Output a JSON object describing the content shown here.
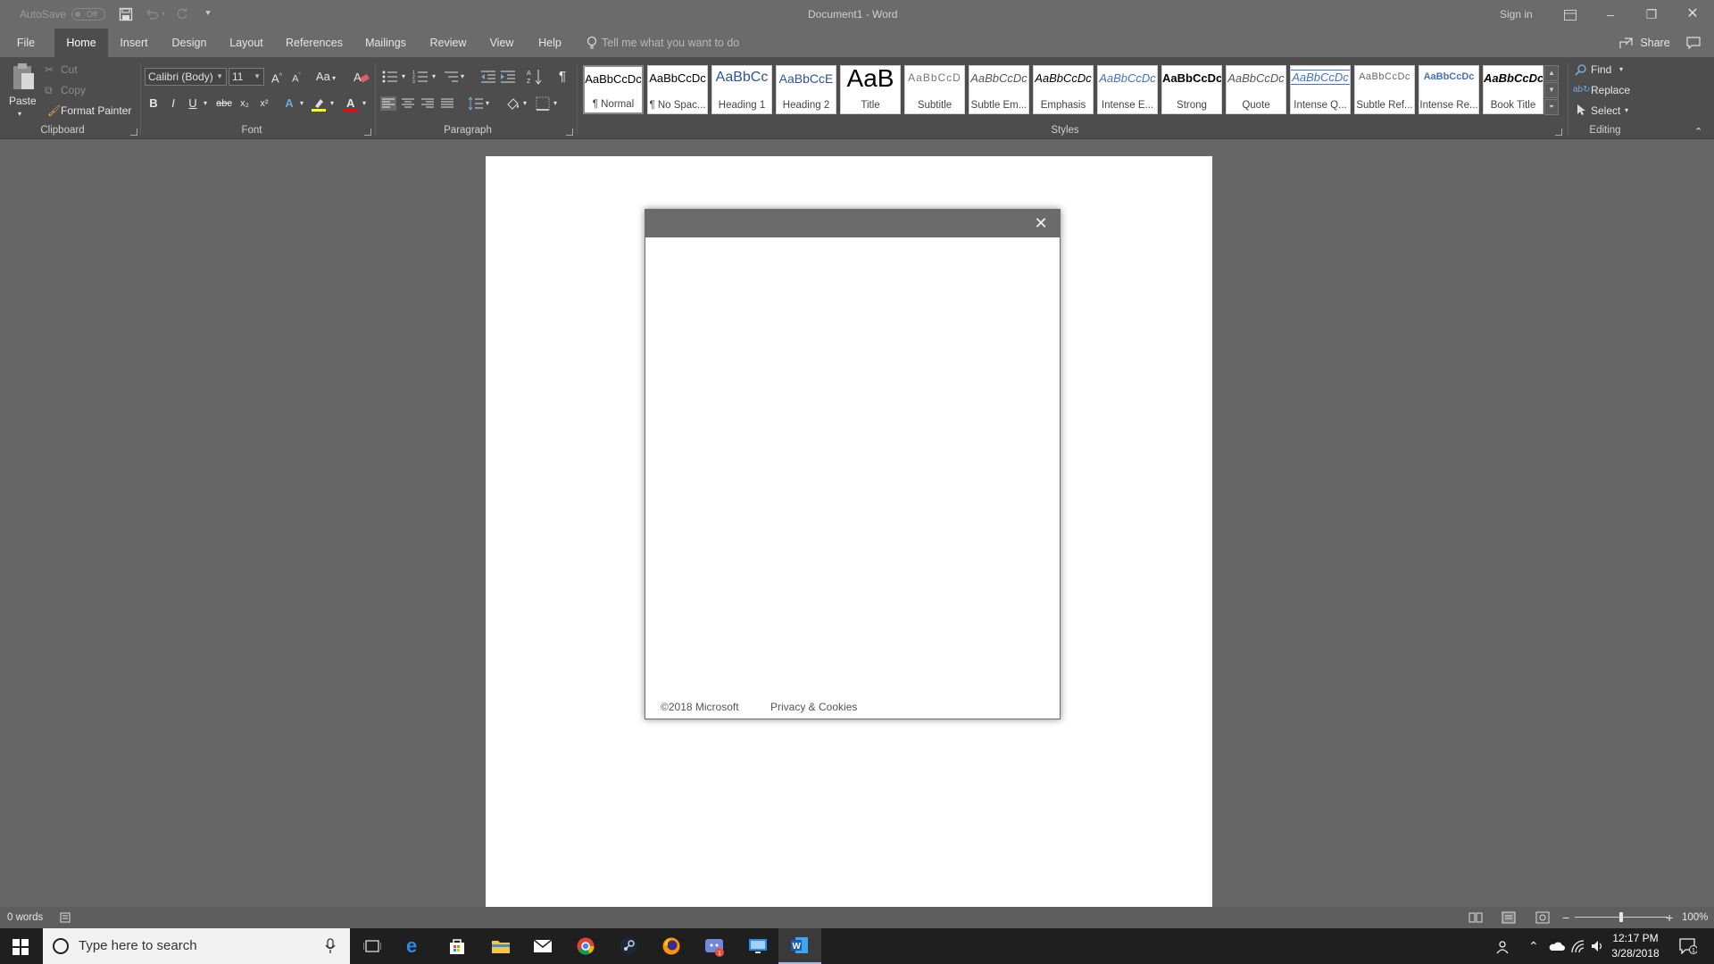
{
  "titlebar": {
    "autosave_label": "AutoSave",
    "autosave_state": "Off",
    "doc_title": "Document1 - Word",
    "sign_in": "Sign in"
  },
  "tabs": [
    "File",
    "Home",
    "Insert",
    "Design",
    "Layout",
    "References",
    "Mailings",
    "Review",
    "View",
    "Help"
  ],
  "tell_me_placeholder": "Tell me what you want to do",
  "share_label": "Share",
  "clipboard": {
    "paste": "Paste",
    "cut": "Cut",
    "copy": "Copy",
    "format_painter": "Format Painter",
    "group_label": "Clipboard"
  },
  "font": {
    "family": "Calibri (Body)",
    "size": "11",
    "change_case": "Aa",
    "bold": "B",
    "italic": "I",
    "underline": "U",
    "strike": "abc",
    "subscript": "x₂",
    "superscript": "x²",
    "group_label": "Font"
  },
  "paragraph": {
    "group_label": "Paragraph"
  },
  "styles": {
    "group_label": "Styles",
    "items": [
      {
        "sample": "AaBbCcDc",
        "name": "¶ Normal"
      },
      {
        "sample": "AaBbCcDc",
        "name": "¶ No Spac..."
      },
      {
        "sample": "AaBbCc",
        "name": "Heading 1"
      },
      {
        "sample": "AaBbCcE",
        "name": "Heading 2"
      },
      {
        "sample": "AaB",
        "name": "Title"
      },
      {
        "sample": "AaBbCcD",
        "name": "Subtitle"
      },
      {
        "sample": "AaBbCcDc",
        "name": "Subtle Em..."
      },
      {
        "sample": "AaBbCcDc",
        "name": "Emphasis"
      },
      {
        "sample": "AaBbCcDc",
        "name": "Intense E..."
      },
      {
        "sample": "AaBbCcDc",
        "name": "Strong"
      },
      {
        "sample": "AaBbCcDc",
        "name": "Quote"
      },
      {
        "sample": "AaBbCcDc",
        "name": "Intense Q..."
      },
      {
        "sample": "AaBbCcDc",
        "name": "Subtle Ref..."
      },
      {
        "sample": "AaBbCcDc",
        "name": "Intense Re..."
      },
      {
        "sample": "AaBbCcDc",
        "name": "Book Title"
      }
    ]
  },
  "editing": {
    "find": "Find",
    "replace": "Replace",
    "select": "Select",
    "group_label": "Editing"
  },
  "dialog": {
    "copyright": "©2018 Microsoft",
    "privacy": "Privacy & Cookies"
  },
  "statusbar": {
    "word_count": "0 words",
    "zoom": "100%",
    "zoom_fraction": 0.5
  },
  "taskbar": {
    "search_placeholder": "Type here to search",
    "time": "12:17 PM",
    "date": "3/28/2018",
    "notification_count": "1",
    "chat_badge": "1"
  },
  "colors": {
    "titlebar": "#6b6b6b",
    "ribbon": "#4d4d4d",
    "canvas": "#666666",
    "highlight_yellow": "#ffff00",
    "font_red": "#ff0000",
    "heading_blue": "#2f5496"
  }
}
